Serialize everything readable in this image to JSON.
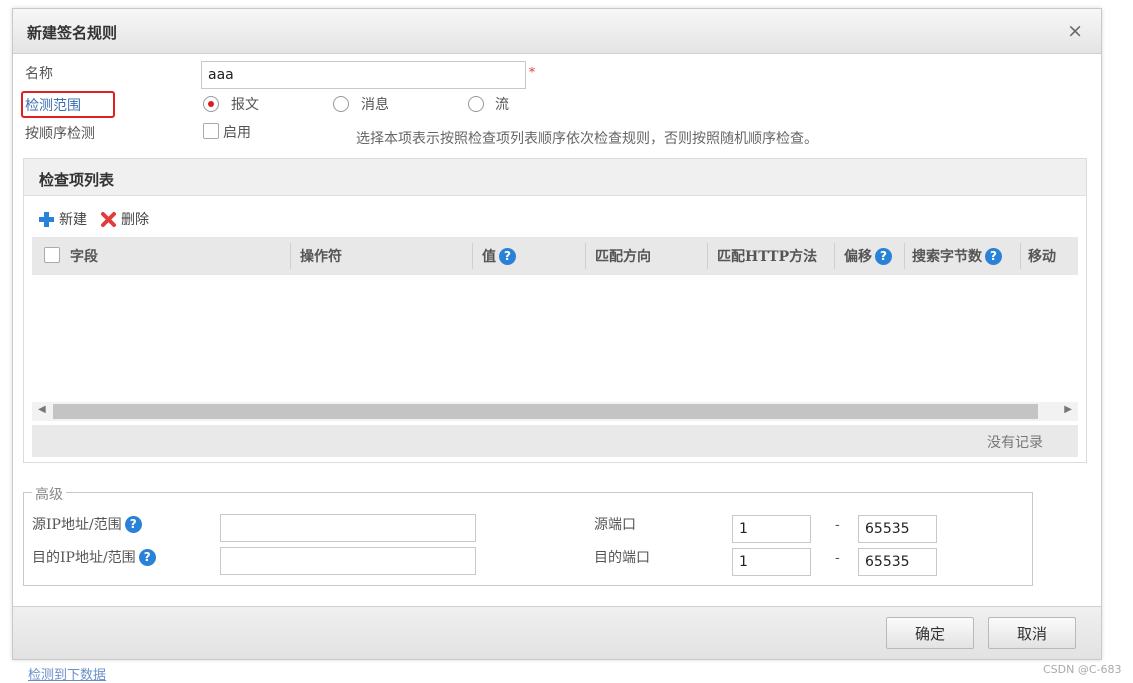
{
  "dialog": {
    "title": "新建签名规则",
    "close_label": "×"
  },
  "form": {
    "name_label": "名称",
    "name_value": "aaa",
    "required_mark": "*",
    "scope_label": "检测范围",
    "scope_options": [
      "报文",
      "消息",
      "流"
    ],
    "scope_selected": "报文",
    "order_label": "按顺序检测",
    "order_enable_label": "启用",
    "order_hint": "选择本项表示按照检查项列表顺序依次检查规则，否则按照随机顺序检查。"
  },
  "check_list": {
    "title": "检查项列表",
    "add_label": "新建",
    "delete_label": "删除",
    "columns": [
      "字段",
      "操作符",
      "值",
      "匹配方向",
      "匹配HTTP方法",
      "偏移",
      "搜索字节数",
      "移动"
    ],
    "empty_text": "没有记录"
  },
  "advanced": {
    "legend": "高级",
    "src_ip_label": "源IP地址/范围",
    "dst_ip_label": "目的IP地址/范围",
    "src_port_label": "源端口",
    "dst_port_label": "目的端口",
    "src_port_from": "1",
    "src_port_to": "65535",
    "dst_port_from": "1",
    "dst_port_to": "65535",
    "dash": "-"
  },
  "buttons": {
    "confirm": "确定",
    "cancel": "取消"
  },
  "background": {
    "link_text": "检测到下数据",
    "watermark": "CSDN @C-683"
  },
  "colors": {
    "highlight_box": "#e02020",
    "radio_selected": "#d81e1e",
    "help_icon": "#2a82d8",
    "delete_icon": "#e23b3b",
    "add_icon": "#2a82d8"
  }
}
